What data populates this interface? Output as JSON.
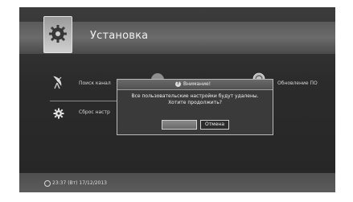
{
  "header": {
    "title": "Установка",
    "icon": "settings-gear-icon"
  },
  "menu": {
    "items": [
      {
        "label": "Поиск канал",
        "icon": "satellite-dish-icon"
      },
      {
        "label": "Сброс настр",
        "icon": "gear-icon"
      },
      {
        "label": "Обновление ПО",
        "icon": "software-update-icon"
      }
    ]
  },
  "dialog": {
    "title": "Внимание!",
    "icon": "warning-icon",
    "message_line1": "Все пользовательские настройки будут удалены.",
    "message_line2": "Хотите продолжить?",
    "ok_label": "",
    "cancel_label": "Отмена"
  },
  "footer": {
    "datetime": "23:37 (Вт) 17/12/2013",
    "icon": "clock-icon"
  }
}
